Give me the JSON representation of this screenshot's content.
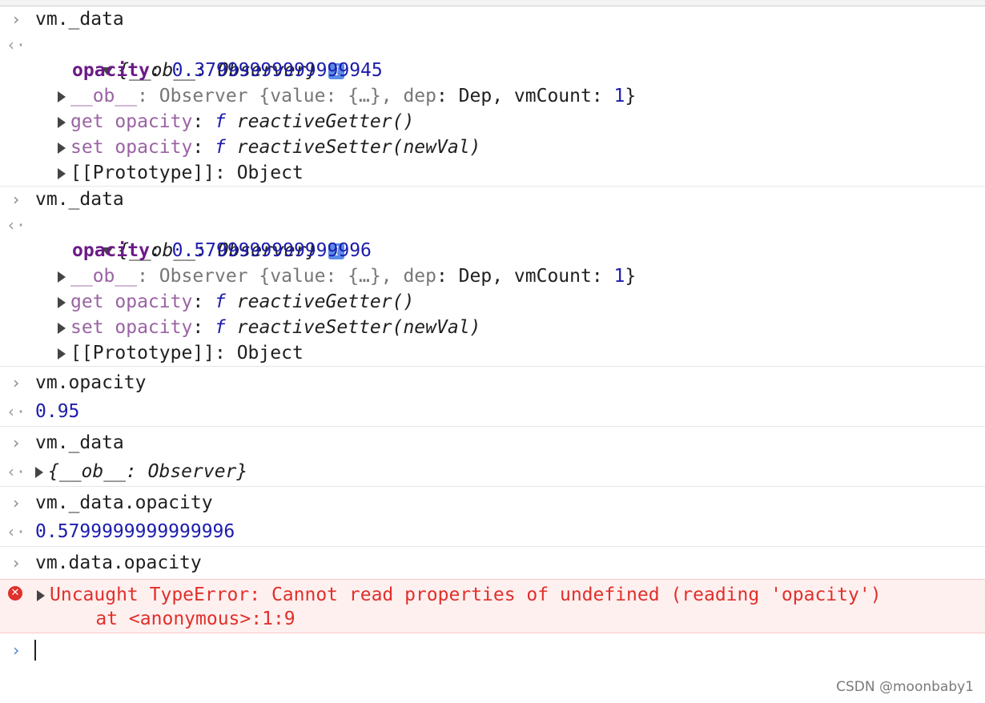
{
  "console": {
    "entries": [
      {
        "input": "vm._data",
        "summary": "{__ob__: Observer}",
        "opacity_key": "opacity",
        "opacity_value": "0.37999999999999945",
        "ob_key": "__ob__",
        "ob_text_a": ": Observer {value: {…}, ",
        "ob_dep": "dep",
        "ob_text_b": ": Dep, vmCount: ",
        "ob_count": "1",
        "ob_close": "}",
        "getter_key": "get opacity",
        "getter_fn": "f",
        "getter_name": "reactiveGetter()",
        "setter_key": "set opacity",
        "setter_fn": "f",
        "setter_name": "reactiveSetter(newVal)",
        "proto": "[[Prototype]]: Object"
      },
      {
        "input": "vm._data",
        "summary": "{__ob__: Observer}",
        "opacity_key": "opacity",
        "opacity_value": "0.5799999999999996",
        "ob_key": "__ob__",
        "ob_text_a": ": Observer {value: {…}, ",
        "ob_dep": "dep",
        "ob_text_b": ": Dep, vmCount: ",
        "ob_count": "1",
        "ob_close": "}",
        "getter_key": "get opacity",
        "getter_fn": "f",
        "getter_name": "reactiveGetter()",
        "setter_key": "set opacity",
        "setter_fn": "f",
        "setter_name": "reactiveSetter(newVal)",
        "proto": "[[Prototype]]: Object"
      }
    ],
    "simple": [
      {
        "input": "vm.opacity",
        "output": "0.95"
      },
      {
        "input": "vm._data",
        "output": "{__ob__: Observer}"
      },
      {
        "input": "vm._data.opacity",
        "output": "0.5799999999999996"
      }
    ],
    "error_input": "vm.data.opacity",
    "error_line1": "Uncaught TypeError: Cannot read properties of undefined (reading 'opacity')",
    "error_line2": "    at <anonymous>:1:9",
    "error_icon": "✕",
    "info_badge": "i",
    "prompt_glyph": "›",
    "result_glyph": "‹·",
    "input_glyph": "›"
  },
  "watermark": "CSDN @moonbaby1",
  "colors": {
    "key": "#6b1a87",
    "number": "#1c1cad",
    "error": "#e0302b",
    "badge": "#5a8ce8"
  }
}
